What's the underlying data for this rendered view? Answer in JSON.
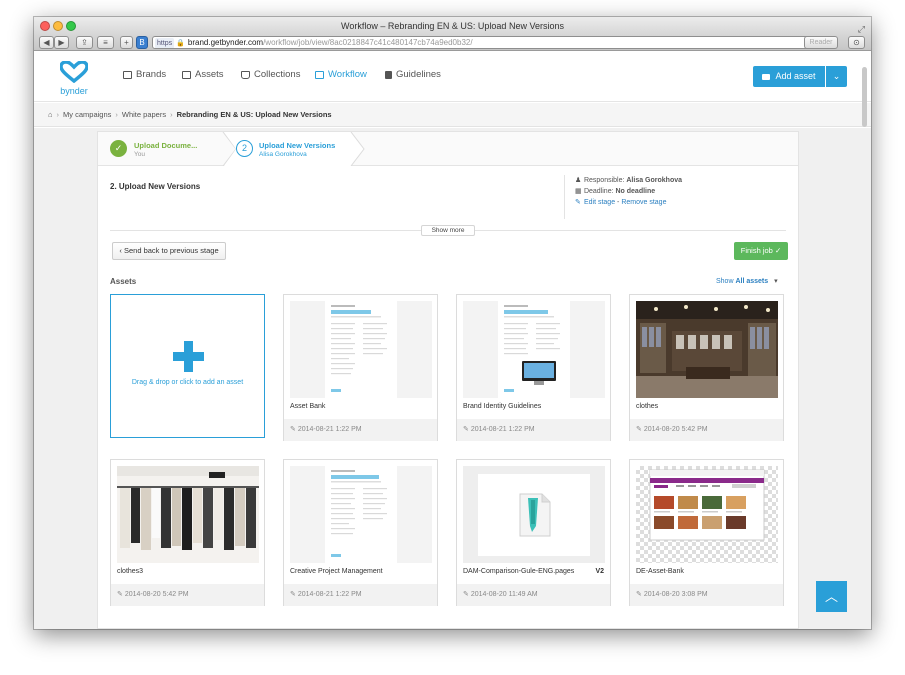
{
  "window": {
    "title": "Workflow – Rebranding EN & US: Upload New Versions"
  },
  "browser": {
    "scheme": "https",
    "host": "brand.getbynder.com",
    "path": "/workflow/job/view/8ac0218847c41c480147cb74a9ed0b32/",
    "reader_label": "Reader"
  },
  "app": {
    "logo_text": "bynder",
    "nav": [
      {
        "label": "Brands",
        "icon": "folder-icon"
      },
      {
        "label": "Assets",
        "icon": "image-icon"
      },
      {
        "label": "Collections",
        "icon": "inbox-icon"
      },
      {
        "label": "Workflow",
        "icon": "check-square-icon",
        "active": true
      },
      {
        "label": "Guidelines",
        "icon": "book-icon"
      }
    ],
    "add_asset_label": "Add asset"
  },
  "breadcrumb": [
    "My campaigns",
    "White papers",
    "Rebranding EN & US: Upload New Versions"
  ],
  "stages": [
    {
      "number": "1",
      "title": "Upload Docume...",
      "subtitle": "You",
      "done": true
    },
    {
      "number": "2",
      "title": "Upload New Versions",
      "subtitle": "Alisa Gorokhova",
      "active": true
    }
  ],
  "task": {
    "title": "2. Upload New Versions",
    "responsible_label": "Responsible:",
    "responsible": "Alisa Gorokhova",
    "deadline_label": "Deadline:",
    "deadline": "No deadline",
    "edit_stage": "Edit stage",
    "remove_stage": "Remove stage",
    "show_more": "Show more",
    "send_back": "Send back to previous stage",
    "finish_job": "Finish job"
  },
  "assets": {
    "heading": "Assets",
    "show_label": "Show",
    "show_value": "All assets",
    "add_text": "Drag & drop or click to add an asset",
    "items": [
      {
        "name": "Asset Bank",
        "date": "2014-08-21 1:22 PM",
        "kind": "doc"
      },
      {
        "name": "Brand Identity Guidelines",
        "date": "2014-08-21 1:22 PM",
        "kind": "doc-monitor"
      },
      {
        "name": "clothes",
        "date": "2014-08-20 5:42 PM",
        "kind": "store"
      },
      {
        "name": "clothes3",
        "date": "2014-08-20 5:42 PM",
        "kind": "rack"
      },
      {
        "name": "Creative Project Management",
        "date": "2014-08-21 1:22 PM",
        "kind": "doc"
      },
      {
        "name": "DAM-Comparison-Gule-ENG.pages",
        "date": "2014-08-20 11:49 AM",
        "kind": "pages",
        "version": "V2"
      },
      {
        "name": "DE-Asset-Bank",
        "date": "2014-08-20 3:08 PM",
        "kind": "web"
      }
    ]
  },
  "colors": {
    "accent": "#2a9fd8",
    "success": "#5cb85c",
    "step_done": "#7ab23f"
  }
}
